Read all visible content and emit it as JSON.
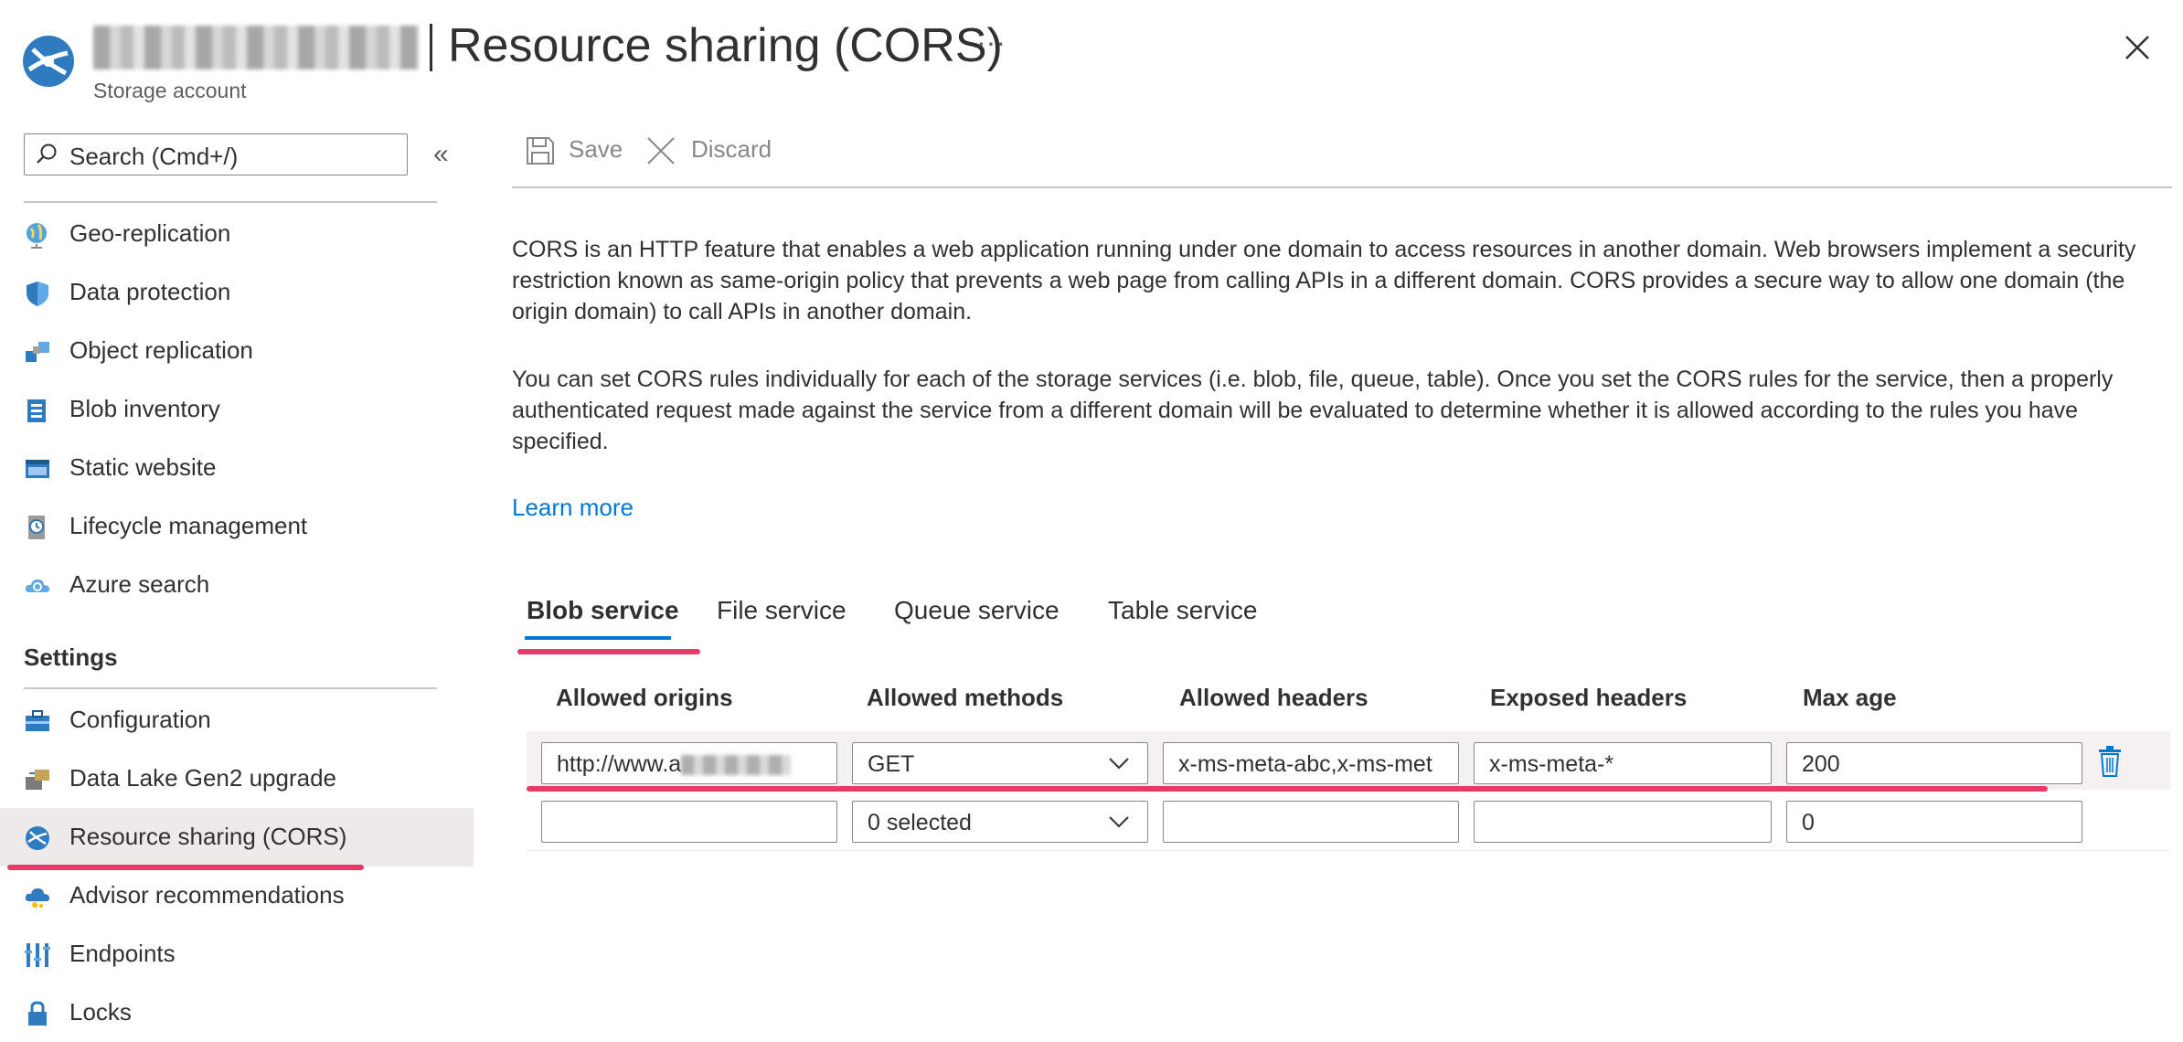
{
  "header": {
    "title": "Resource sharing (CORS)",
    "subtitle": "Storage account",
    "more": "···"
  },
  "sidebar": {
    "search_placeholder": "Search (Cmd+/)",
    "collapse": "«",
    "items": [
      {
        "label": "Geo-replication",
        "icon": "globe-icon"
      },
      {
        "label": "Data protection",
        "icon": "shield-icon"
      },
      {
        "label": "Object replication",
        "icon": "cubes-icon"
      },
      {
        "label": "Blob inventory",
        "icon": "inventory-icon"
      },
      {
        "label": "Static website",
        "icon": "website-icon"
      },
      {
        "label": "Lifecycle management",
        "icon": "lifecycle-icon"
      },
      {
        "label": "Azure search",
        "icon": "cloud-search-icon"
      }
    ],
    "settings_heading": "Settings",
    "settings_items": [
      {
        "label": "Configuration",
        "icon": "toolbox-icon"
      },
      {
        "label": "Data Lake Gen2 upgrade",
        "icon": "upgrade-icon"
      },
      {
        "label": "Resource sharing (CORS)",
        "icon": "cors-icon",
        "active": true
      },
      {
        "label": "Advisor recommendations",
        "icon": "advisor-icon"
      },
      {
        "label": "Endpoints",
        "icon": "endpoints-icon"
      },
      {
        "label": "Locks",
        "icon": "lock-icon"
      }
    ]
  },
  "toolbar": {
    "save_label": "Save",
    "discard_label": "Discard"
  },
  "content": {
    "paragraph1": "CORS is an HTTP feature that enables a web application running under one domain to access resources in another domain. Web browsers implement a security restriction known as same-origin policy that prevents a web page from calling APIs in a different domain. CORS provides a secure way to allow one domain (the origin domain) to call APIs in another domain.",
    "paragraph2": "You can set CORS rules individually for each of the storage services (i.e. blob, file, queue, table). Once you set the CORS rules for the service, then a properly authenticated request made against the service from a different domain will be evaluated to determine whether it is allowed according to the rules you have specified.",
    "learn_more": "Learn more"
  },
  "tabs": [
    {
      "label": "Blob service",
      "active": true
    },
    {
      "label": "File service"
    },
    {
      "label": "Queue service"
    },
    {
      "label": "Table service"
    }
  ],
  "table": {
    "columns": [
      "Allowed origins",
      "Allowed methods",
      "Allowed headers",
      "Exposed headers",
      "Max age"
    ],
    "rows": [
      {
        "origin": "http://www.a",
        "methods": "GET",
        "allowed_headers": "x-ms-meta-abc,x-ms-met",
        "exposed_headers": "x-ms-meta-*",
        "max_age": "200"
      },
      {
        "origin": "",
        "methods": "0 selected",
        "allowed_headers": "",
        "exposed_headers": "",
        "max_age": "0"
      }
    ]
  },
  "colors": {
    "accent": "#0078d4",
    "highlight": "#e8396a",
    "active_bg": "#edebe9"
  }
}
